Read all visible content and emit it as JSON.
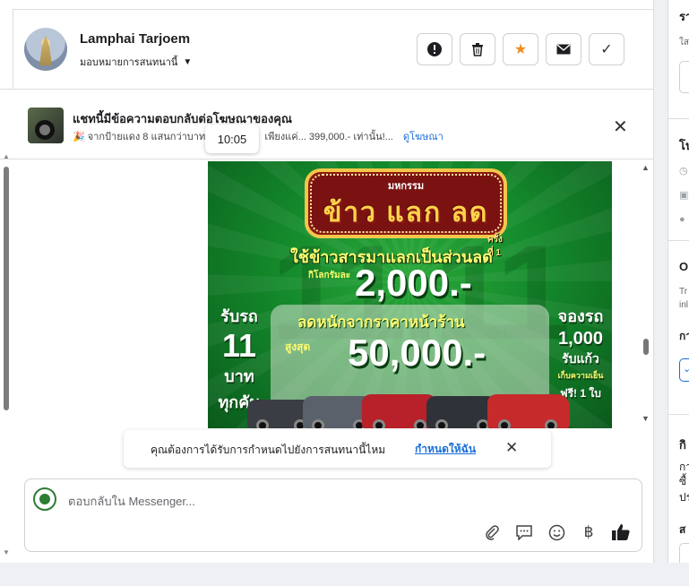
{
  "header": {
    "contact_name": "Lamphai Tarjoem",
    "assign_label": "มอบหมายการสนทนานี้",
    "buttons": {
      "report_icon": "!",
      "delete_icon": "🗑",
      "star_icon": "★",
      "email_icon": "✉",
      "done_icon": "✓"
    }
  },
  "ad_banner": {
    "title": "แชทนี้มีข้อความตอบกลับต่อโฆษณาของคุณ",
    "subtitle_prefix": "🎉 จากป้ายแดง 8 แสนกว่าบาท",
    "subtitle_suffix": "เพียงแค่... 399,000.- เท่านั้น!...",
    "link": "ดูโฆษณา"
  },
  "message": {
    "timestamp": "10:05",
    "promo": {
      "marquee_top": "มหกรรม",
      "marquee_main": "ข้าว แลก ลด",
      "marquee_round": "ครั้งที่ 1",
      "line1": "ใช้ข้าวสารมาแลกเป็นส่วนลด",
      "line2_prefix": "กิโลกรัมละ",
      "line2_value": "2,000.-",
      "line3": "ลดหนักจากราคาหน้าร้าน",
      "line4_prefix": "สูงสุด",
      "line4_value": "50,000.-",
      "left_a": "รับรถ",
      "left_b": "11",
      "left_c": "บาท",
      "left_d": "ทุกคัน",
      "right_a": "จองรถ",
      "right_b": "1,000",
      "right_c": "รับแก้ว",
      "right_d": "เก็บความเย็น",
      "right_e": "ฟรี! 1 ใบ"
    }
  },
  "reminder": {
    "text": "คุณต้องการได้รับการกำหนดไปยังการสนทนานี้ไหม",
    "link": "กำหนดให้ฉัน"
  },
  "composer": {
    "placeholder": "ตอบกลับใน Messenger..."
  },
  "sidebar": {
    "fragments": [
      "รา",
      "ใส",
      "โป",
      "O",
      "Tr",
      "inl",
      "กา",
      "กิ",
      "กา",
      "ซื้",
      "ปร",
      "ส"
    ]
  },
  "colors": {
    "accent": "#1a6fd8",
    "star": "#f08c21",
    "promo_green": "#148a2b",
    "marquee_red": "#7b1212"
  }
}
